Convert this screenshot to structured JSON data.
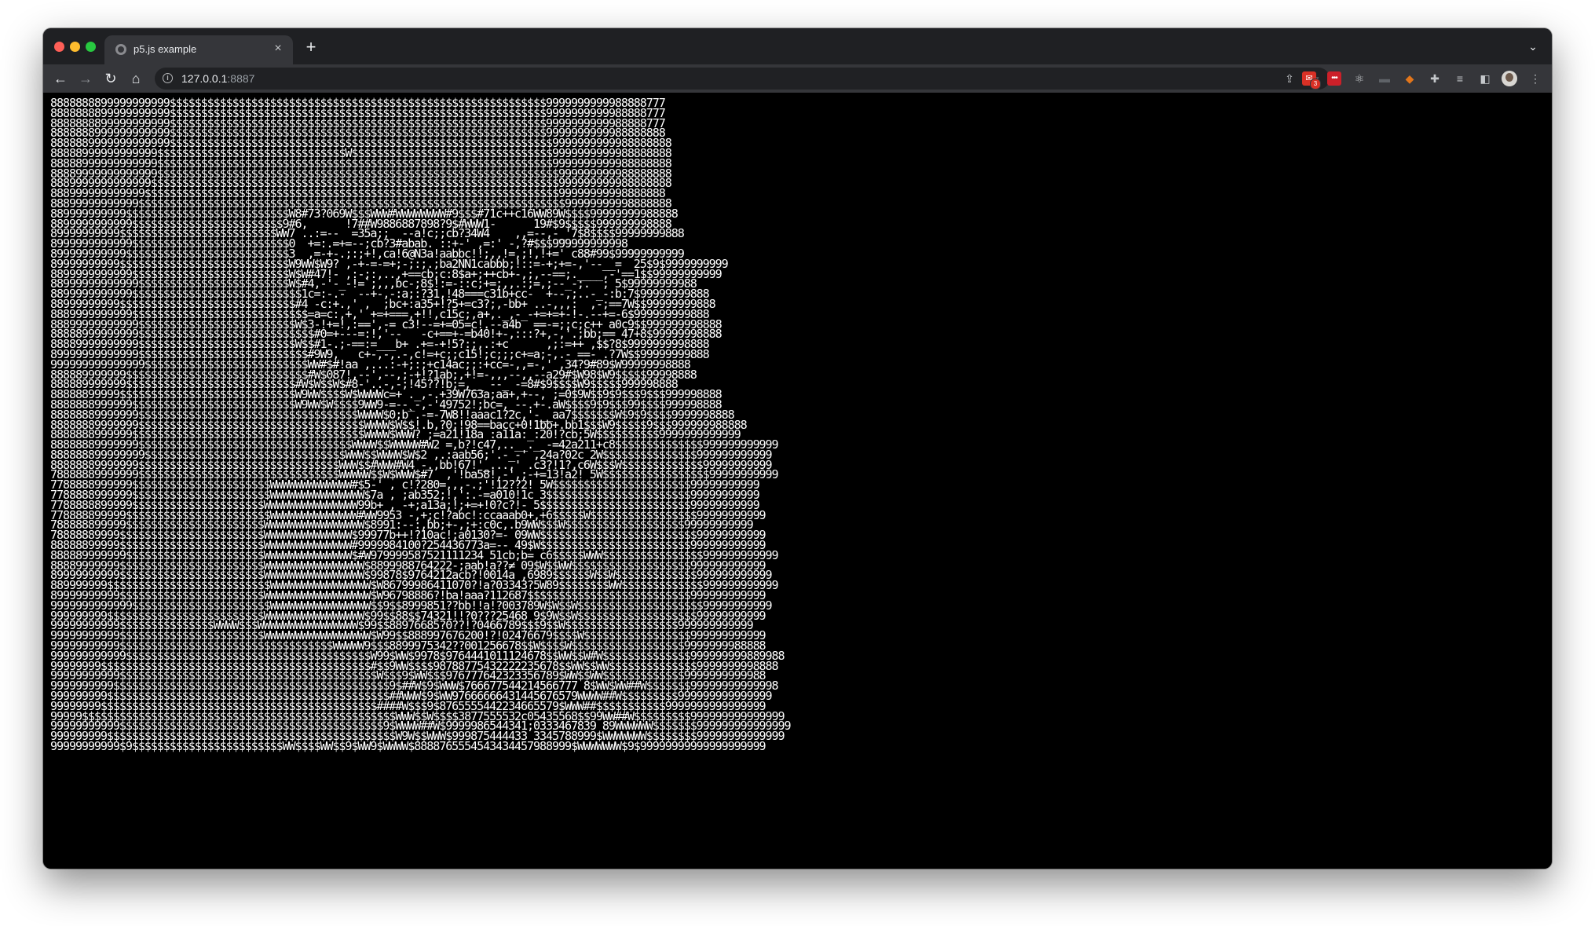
{
  "browser": {
    "tab_title": "p5.js example",
    "tab_close": "×",
    "new_tab": "+",
    "tab_list": "⌄",
    "url_host": "127.0.0.1",
    "url_port": ":8887",
    "nav": {
      "back": "←",
      "forward": "→",
      "reload": "↻",
      "home": "⌂"
    },
    "extensions": [
      {
        "name": "gmail-extension-icon",
        "badge": "3"
      },
      {
        "name": "lastpass-extension-icon"
      },
      {
        "name": "react-devtools-icon"
      },
      {
        "name": "screen-extension-icon"
      },
      {
        "name": "metamask-fox-icon"
      },
      {
        "name": "extensions-puzzle-icon"
      },
      {
        "name": "reading-list-icon"
      },
      {
        "name": "side-panel-icon"
      },
      {
        "name": "profile-avatar-icon"
      },
      {
        "name": "menu-kebab-icon"
      }
    ]
  },
  "page": {
    "ascii_art": "8888888899999999999$$$$$$$$$$$$$$$$$$$$$$$$$$$$$$$$$$$$$$$$$$$$$$$$$$$$$$$$$$$$9999999999988888777\n8888888899999999999$$$$$$$$$$$$$$$$$$$$$$$$$$$$$$$$$$$$$$$$$$$$$$$$$$$$$$$$$$$$9999999999988888777\n8888888899999999999$$$$$$$$$$$$$$$$$$$$$$$$$$$$$$$$$$$$$$$$$$$$$$$$$$$$$$$$$$$$9999999999988888777\n8888888999999999999$$$$$$$$$$$$$$$$$$$$$$$$$$$$$$$$$$$$$$$$$$$$$$$$$$$$$$$$$$$$9999999999988888888\n8888889999999999999$$$$$$$$$$$$$$$$$$$$$$$$$$$$$$$$$$$$$$$$$$$$$$$$$$$$$$$$$$$$$9999999999988888888\n88888999999999999$$$$$$$$$$$$$$$$$$$$$$$$$$$$$$W$$$$$$$$$$$$$$$$$$$$$$$$$$$$$$$$9999999999988888888\n88888999999999999$$$$$$$$$$$$$$$$$$$$$$$$$$$$$$$$$$$$$$$$$$$$$$$$$$$$$$$$$$$$$$$9999999999988888888\n88889999999999999$$$$$$$$$$$$$$$$$$$$$$$$$$$$$$$$$$$$$$$$$$$$$$$$$$$$$$$$$$$$$$$$999999999988888888\n8889999999999999$$$$$$$$$$$$$$$$$$$$$$$$$$$$$$$$$$$$$$$$$$$$$$$$$$$$$$$$$$$$$$$$$999999999988888888\n888999999999999$$$$$$$$$$$$$$$$$$$$$$$$$$$$$$$$$$$$$$$$$$$$$$$$$$$$$$$$$$$$$$$$$$99999999998888888\n88899999999999$$$$$$$$$$$$$$$$$$$$$$$$$$$$$$$$$$$$$$$$$$$$$$$$$$$$$$$$$$$$$$$$$$$$99999999998888888\n889999999999$$$$$$$$$$$$$$$$$$$$$$$$$$W8#73?069W$$$WWW#WWWWWWWW#9$$$#71c++c16WW89W$$$$99999999988888\n8899999999999$$$$$$$$$$$$$$$$$$$$$$$$9#6,      !7##W9886887898?9$#WWW1-      19#$9$$$$$999999998888\n89999999999$$$$$$$$$$$$$$$$$$$$$$$$$WW7 ..:=--  =35a;;  --a!c;;cb?34W4    ,,=--,-_'7$8$$$$99999999888\n8999999999999$$$$$$$$$$$$$$$$$$$$$$$$$0  +=:.=+=--;cb?3#abab. ::+-' ,=:' -,?#$$$999999999998\n899999999999$$$$$$$$$$$$$$$$$$$$$$$$$$3  ,=-+-.;:;+!,ca!6@N3a!aabbc!!;,,!=,;!,!+=' c88#99$99999999999\n89999999999$$$$$$$$$$$$$$$$$$$$$$$$$$$W9WW$W9? ,-+-=-=+;-;:;.;ba2NN1cabbb;!::=-+;+=-,'--__=  25$9$9999999999\n8899999999999$$$$$$$$$$$$$$$$$$$$$$$$$W$W#47!- ,:-;:,..,+==cb;c:8$a+;++cb+-,;,--==;.____,-'==1$$99999999999\n88999999999999$$$$$$$$$$$$$$$$$$$$$$$$W$#4,-'-_-!=`;,,,bc-;8$!:=-::c;+=;,,.:;=,;--_-;.  ; 5$99999999988\n8899999999999$$$$$$$$$$$$$$$$$$$$$$$$$$$1c=:-.-  --+-,-:a;:?31,!48===c31b+cc-  +--,;..-_-:b:7$99999999888\n88999999999$$$$$$$$$$$$$$$$$$$$$$$$$$$$#4 -c:+.,' ,  ;bc+:a35+!?5+=c3?;,-bb+ ..-,,,:  ,-;==7W$$99999999888\n8889999999999$$$$$$$$$$$$$$$$$$$$$$$$$$$$=a=c:,+,' +=+===,+!!,c15c;,a+,._,-_-+=+=+-!-.--+=-6$999999999888\n88899999999999$$$$$$$$$$$$$$$$$$$$$$$$$W$3-!+=!,:==',-= c3!--=+=05=c!.--a4b  ==-=;;c;c++ a0c9$$999999998888\n88888999999999$$$$$$$$$$$$$$$$$$$$$$$$$$$$#0=+---=:!,'--   -c+==+-=b40!+-,:::?+,-,'.;bb;== 47+8$99999998888\n88889999999999$$$$$$$$$$$$$$$$$$$$$$$$$W$$#1-.;-==:=___b+ .+=-+!5?:;,.:+c      ,;:=++ ,$$?8$9999999998888\n89999999999999$$$$$$$$$$$$$$$$$$$$$$$$$$$#9W9,   c+-,-,.-,c!=+c;;c15!;c;;;c+=a;-,.-_==- .?7W$$99999999888\n999999999999999$$$$$$$$$$$$$$$$$$$$$$$$$$WW#$#!aa ,...:-+;:;+c14ac;;:+cc=-,,=-,' ,34?9#89$W99999998888\n888889999999$$$$$$$$$$$$$$$$$$$$$$$$$$$$$#W$087!,--',--,;-+!?1ab;,+!=-,,,--,,--a29#$W98$W9$$$$$99998888\n888889999999$$$$$$$$$$$$$$$$$$$$$$$$$$$#W$W$$W$#8-'..-,-;!45??!b;=,__ --_ -=8#$9$$$$W9$$$$$999998888\n88888899999$$$$$$$$$$$$$$$$$$$$$$$$$$$$W9WW$$$$W$WWWWc=+ ._,-.+39W763a;aa+,+--, ;=0$9W$$9$9$$$9$$$999998888\n8888888999999$$$$$$$$$$$$$$$$$$$$$$$$$$W9WW$W$$$$9WW9-=--_-,-'49752!;bc=,_--.+-.aW$$$$9$9$$$99$$$$999998888\n88888889999999$$$$$$$$$$$$$$$$$$$$$$$$$$$$$$$$$$$WWWW$0;b`.-=-7W8!!aaac1?2c,'-__aa7$$$$$$$W$9$9$$$$9999998888\n88888889999999$$$$$$$$$$$$$$$$$$$$$$$$$$$$$$$$$$$$WWWW$W$$!.b,?0;!98==bacc+0!1bb+.bb1$$$W9$$$$$9$$$999999988888\n8888888999999$$$$$$$$$$$$$$$$$$$$$$$$$$$$$$$$$$$$$WWWW$WWW? ;=a21!18a :a11a:_:20!?cb;5W$$$$$$$$$$9999999999999\n88888889999999$$$$$$$$$$$$$$$$$$$$$$$$$$$$$$$$$$WWWW$$WWWWW#W2 =,b?!c47,..__._ -=42a211+c8$$$$$$$$$$$$$$999999999999\n888888899999999$$$$$$$$$$$$$$$$$$$$$$$$$$$$$$$$WWW$$WWWW$W$2 ,.:aab56;'.-_-' ,24a?02c 2W$$$$$$$$$$$$$$$999999999999\n88888889999999$$$$$$$$$$$$$$$$$$$$$$$$$$$$$$$$WWW$$#WWW#W4 -.,bb!67!'_...,' .c3?!1?,c6W$$$W$$$$$$$$$$$$$99999999999\n78888889999999$$$$$$$$$$$$$$$$$$$$$$$$$$$$$$$$WWWWW$$W$WWW$#7  ,'!ba58!,-',;-+=13!a2! 5W$$$$$$$$$$$$$$$$$99999999999\n7788888999999$$$$$$$$$$$$$$$$$$$$$$WWWWWWWWWWWWW#$5-' , c!?280=,,,-.;'!12??2! 5W$$$$$$$$$$$$$$$$$$$$$$99999999999\n7788888999999$$$$$$$$$$$$$$$$$$$$$$WWWWWWWWWWWWWWW$7a , ;ab352;!,':.-=a010!1c 3$$$$$$$$$$$$$$$$$$$$$$$99999999999\n7788888899999$$$$$$$$$$$$$$$$$$$$$WWWWWWWWWWWWWWW99b+ , -+;a13a;!;+=+!0?c?!- 5$$$$$$$$$$$$$$$$$$$$$$$$99999999999\n778888899999$$$$$$$$$$$$$$$$$$$$$$$WWWWWWWWWWWWWW#WW9953 -,+;c!?abc!:ccaaab0+,+6$$$$$W$$$$$$$$$$$$$$$$$99999999999\n788888899999$$$$$$$$$$$$$$$$$$$$$$WWWWWWWWWWWWWWWW$8991:--:,bb;+-,;+:c0c,.b9WW$$$W$$$$$$$$$$$$$$$$$$$99999999999\n78888889999$$$$$$$$$$$$$$$$$$$$$$$WWWWWWWWWWWWWW$99977b++!?10ac!;a0130?=- 09WW$$$$$$$$$$$$$$$$$$$$$$$$$99999999999\n88888899999$$$$$$$$$$$$$$$$$$$$$$$WWWWWWWWWWWWWW#9999984100?254436773a=-- 49$W$$$$$$$$$$$$$$$$$$$$$$$$999999999999\n888889999999$$$$$$$$$$$$$$$$$$$$$$WWWWWWWWWWWWWW$#W979999587521111234 51cb;b= c6$$$$$WWW$$$$$$$$$$$$$$$$999999999999\n88889999999$$$$$$$$$$$$$$$$$$$$$$$WWWWWWWWWWWWWWWW$8899988764222-;aab!a??≠ 09$W$$WW$$$$$$$$$$$$$$$$$$$999999999999\n89999999999$$$$$$$$$$$$$$$$$$$$$$$WWWWWWWWWWWWWWWW$99878$9764212acb?!0014a ,6989$$$$$$W$$W$$$$$$$$$$$$$999999999999\n889999999$$$$$$$$$$$$$$$$$$$$$$$$$$WWWWWWWWWWWWWWWW$W86799986411070?!a?03343?5W89$$$$$$$$WW$$$$$$$$$$$$$999999999999\n89999999999$$$$$$$$$$$$$$$$$$$$$$$WWWWWWWWWWWWWWWWW$W96798886?!ba!aaa?112687$$$$$$$$$$$$$$$$$$$$$$$$$$999999999999\n9999999999999$$$$$$$$$$$$$$$$$$$$$$WWWWWWWWWWWWWWWW$$9$$8999851??bb!!a!?003789W$W$$W$$$$$$$$$$$$$$$$$$$$99999999999\n999999999$$$$$$$$$$$$$$$$$$$$$$$$$WWWWWWWWWWWWWWWW$99$$88$$74321!!?0???25468 9$9W$$W$$$$$$$$$$$$$$$$$$$99999999999\n99999999999$$$$$$$$$$$$$$$WWWW$$$WWWWWWWWWWWWWWWW$99$$88976685?0??!?0466789$$$9$$W$$$$$$$$$$$$$$$$$$999999999999\n99999999999$$$$$$$$$$$$$$$$$$$$$$$WWWWWWWWWWWWWWWWW$W99$$888997676200!?!02476679$$$$W$$$$$$$$$$$$$$$$$999999999999\n99999999999$$$$$$$$$$$$$$$$$$$$$$$$$$$$$$$$$$WWWWW9$$$8899975342??001256678$$W$$$$W$$$$$$$$$$$$$$$$$$9999999988888\n999999999999$$$$$$$$$$$$$$$$$$$$$$$$$$$$$$$$$$$$$$$W99$WW$9978$9764441011124678$$WW$$W#W$$$$$$$$$$$$$$999999999889988\n99999999$$$$$$$$$$$$$$$$$$$$$$$$$$$$$$$$$$$$$$$$$$$#$$9WW$$$$98788775432222235678$$WW$$WW$$$$$$$$$$$$$$9999999998888\n99999999999$$$$$$$$$$$$$$$$$$$$$$$$$$$$$$$$$$$$$$$$$W$$$9$WW$$$976777642323356789$WW$$WW$$$$$$$$$$$$$9999999999988\n9999999999$$$$$$$$$$$$$$$$$$$$$$$$$$$$$$$$$$$$$$$$$$$$9$##W$9$WWW$766677544214566777 8$WW$WW##W$$$$$$$99999999999998\n999999999$$$$$$$$$$$$$$$$$$$$$$$$$$$$$$$$$$$$$$$$$$$$$##WWW$9$WW97666666431445676579WWWW##W$$$$$$$$$999999999999999\n99999999$$$$$$$$$$$$$$$$$$$$$$$$$$$$$$$$$$$$$$$$$$$$####W$$$9$8765555442234665579$WWW##$$$$$$$$$$$9999999999999999\n99999$$$$$$$$$$$$$$$$$$$$$$$$$$$$$$$$$$$$$$$$$$$$$$$$$$WWW$$W$$$$3877555532c05435568$$99WW##W$$$$$$$$$999999999999999\n99999999999$$$$$$$$$$$$$$$$$$$$$$$$$$$$$$$$$$$$$$$$$$9$WWWW##W$9999986544341;0333467839 89WWWWWW$$$$$$$999999999999999\n999999999$$$$$$$$$$$$$$$$$$$$$$$$$$$$$$$$$$$$$$$$$$$$$$W9W$$WWW$999875444433 3345788999$WWWWWWW$$$$$$$$99999999999999\n99999999999$9$$$$$$$$$$$$$$$$$$$$$$$$WW$$$$WW$$9$WW9$WWWW$8888765554543434457988999$WWWWWWW$9$99999999999999999999"
  }
}
